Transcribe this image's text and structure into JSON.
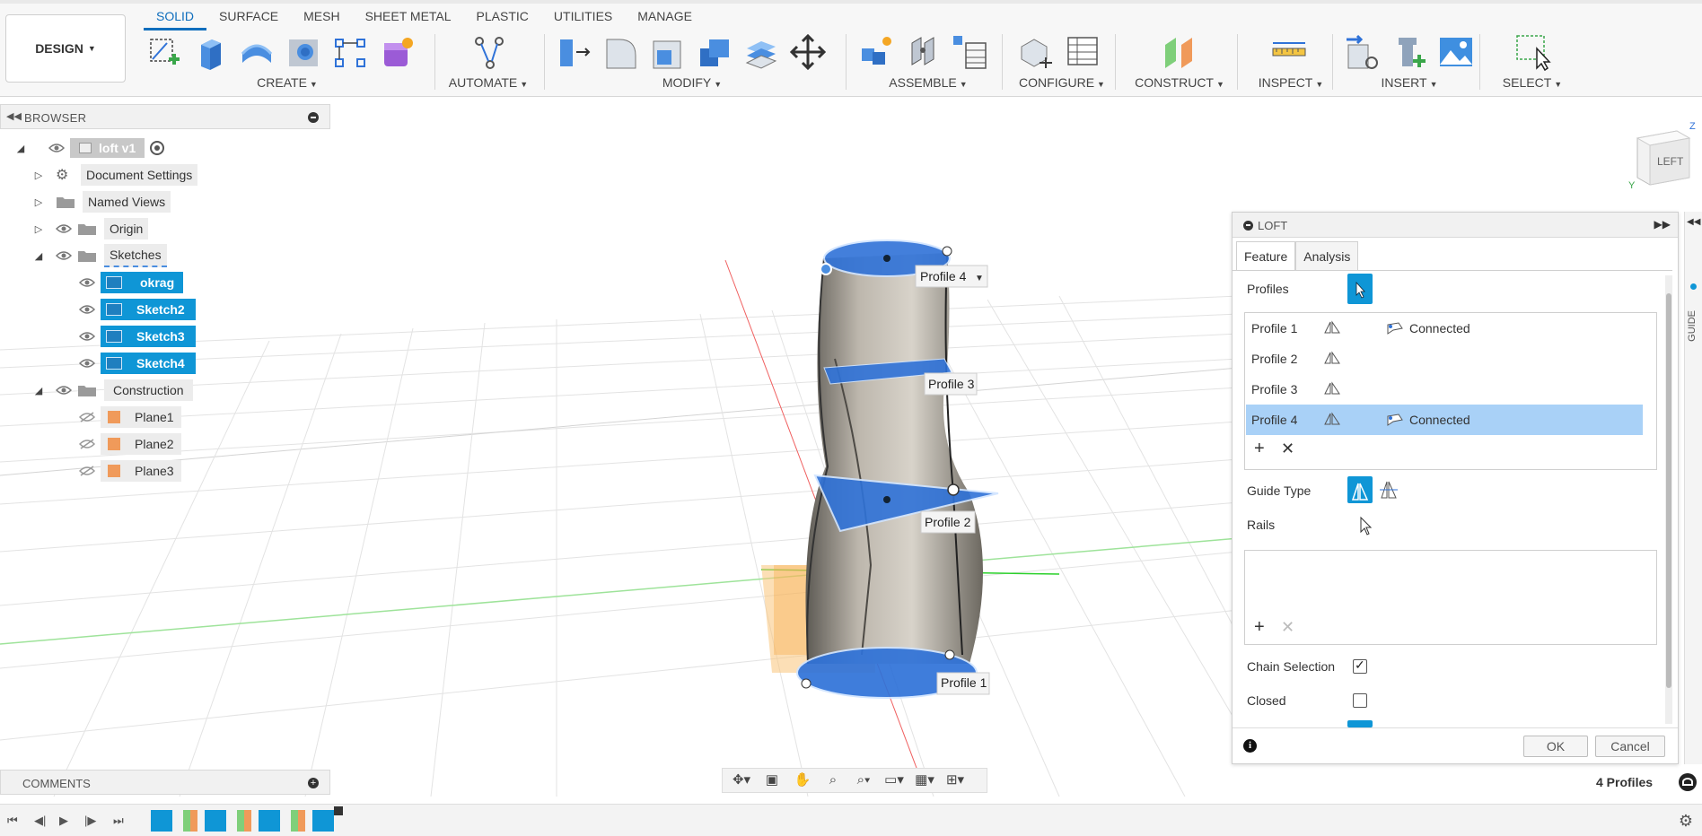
{
  "toolbar": {
    "workspace": "DESIGN",
    "tabs": [
      "SOLID",
      "SURFACE",
      "MESH",
      "SHEET METAL",
      "PLASTIC",
      "UTILITIES",
      "MANAGE"
    ],
    "active_tab": "SOLID",
    "groups": {
      "create": "CREATE",
      "automate": "AUTOMATE",
      "modify": "MODIFY",
      "assemble": "ASSEMBLE",
      "configure": "CONFIGURE",
      "construct": "CONSTRUCT",
      "inspect": "INSPECT",
      "insert": "INSERT",
      "select": "SELECT"
    }
  },
  "browser": {
    "title": "BROWSER",
    "root": "loft v1",
    "items": [
      {
        "label": "Document Settings",
        "icon": "gear-icon"
      },
      {
        "label": "Named Views",
        "icon": "folder-icon"
      },
      {
        "label": "Origin",
        "icon": "folder-icon"
      },
      {
        "label": "Sketches",
        "icon": "folder-icon"
      },
      {
        "label": "okrag",
        "icon": "sketch-icon"
      },
      {
        "label": "Sketch2",
        "icon": "sketch-icon"
      },
      {
        "label": "Sketch3",
        "icon": "sketch-icon"
      },
      {
        "label": "Sketch4",
        "icon": "sketch-icon"
      },
      {
        "label": "Construction",
        "icon": "folder-icon"
      },
      {
        "label": "Plane1",
        "icon": "plane-icon"
      },
      {
        "label": "Plane2",
        "icon": "plane-icon"
      },
      {
        "label": "Plane3",
        "icon": "plane-icon"
      }
    ]
  },
  "viewport": {
    "labels": {
      "profile1": "Profile 1",
      "profile2": "Profile 2",
      "profile3": "Profile 3",
      "profile4": "Profile 4"
    },
    "viewcube_face": "LEFT",
    "axis_z": "Z",
    "axis_y": "Y"
  },
  "loft": {
    "title": "LOFT",
    "tabs": [
      "Feature",
      "Analysis"
    ],
    "profiles_label": "Profiles",
    "profiles": [
      {
        "name": "Profile 1",
        "status": "Connected",
        "selected": false
      },
      {
        "name": "Profile 2",
        "status": "",
        "selected": false
      },
      {
        "name": "Profile 3",
        "status": "",
        "selected": false
      },
      {
        "name": "Profile 4",
        "status": "Connected",
        "selected": true
      }
    ],
    "guide_type_label": "Guide Type",
    "rails_label": "Rails",
    "chain_selection_label": "Chain Selection",
    "chain_selection_checked": true,
    "closed_label": "Closed",
    "closed_checked": false,
    "ok": "OK",
    "cancel": "Cancel",
    "side_tab": "GUIDE"
  },
  "comments": {
    "title": "COMMENTS"
  },
  "status": {
    "profiles_count": "4 Profiles"
  },
  "colors": {
    "accent": "#0f96d6",
    "selection": "#a9d1f7",
    "profile_fill": "#2f72d8"
  }
}
